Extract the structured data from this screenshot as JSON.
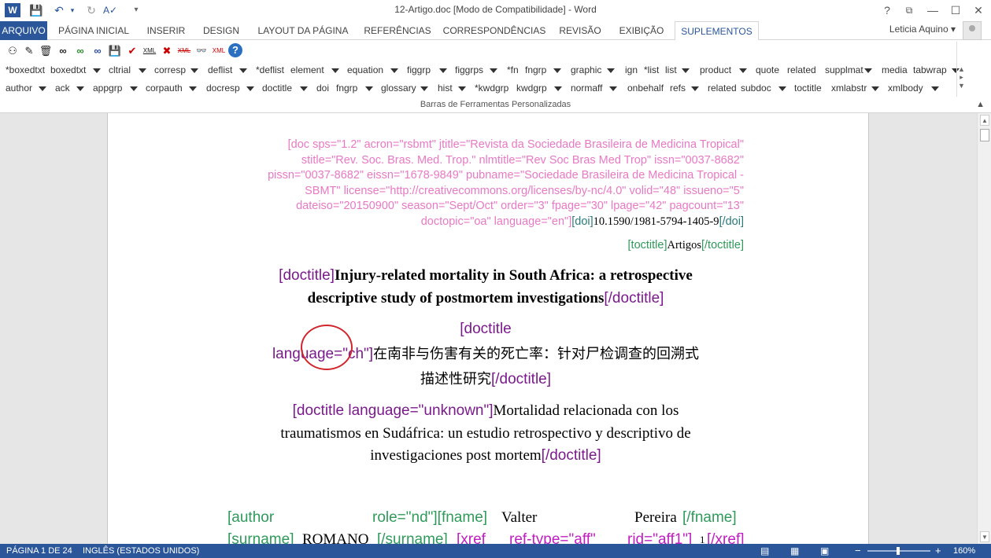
{
  "window": {
    "title": "12-Artigo.doc [Modo de Compatibilidade] - Word",
    "help": "?",
    "restore_ribbon": "⧉",
    "minimize": "—",
    "maximize": "☐",
    "close": "✕"
  },
  "quick_access": {
    "app_icon": "W",
    "save_icon": "💾",
    "undo_icon": "↶",
    "redo_icon": "↻",
    "spell_icon": "A✓",
    "customize_icon": "▾"
  },
  "tabs": [
    {
      "label": "ARQUIVO"
    },
    {
      "label": "PÁGINA INICIAL"
    },
    {
      "label": "INSERIR"
    },
    {
      "label": "DESIGN"
    },
    {
      "label": "LAYOUT DA PÁGINA"
    },
    {
      "label": "REFERÊNCIAS"
    },
    {
      "label": "CORRESPONDÊNCIAS"
    },
    {
      "label": "REVISÃO"
    },
    {
      "label": "EXIBIÇÃO"
    },
    {
      "label": "SUPLEMENTOS"
    }
  ],
  "user": {
    "name": "Leticia Aquino"
  },
  "toolbar_icons": [
    "person-icon",
    "pen-icon",
    "trash-icon",
    "glasses-icon",
    "glasses-green-icon",
    "glasses-blue-icon",
    "floppy-icon",
    "checkmark-icon",
    "xml-icon",
    "x-icon",
    "xml-strike-icon",
    "view-icon",
    "xml-grid-icon",
    "help-icon"
  ],
  "toolbar_icon_glyphs": [
    "⚇",
    "✎",
    "🗑",
    "∞",
    "∞",
    "∞",
    "💾",
    "✔",
    "XML",
    "✖",
    "XML",
    "👓",
    "XML",
    "?"
  ],
  "toolbar_row1": [
    "*boxedtxt",
    "boxedtxt",
    "cltrial",
    "corresp",
    "deflist",
    "*deflist",
    "element",
    "equation",
    "figgrp",
    "figgrps",
    "*fn",
    "fngrp",
    "graphic",
    "ign",
    "*list",
    "list",
    "product",
    "quote",
    "related",
    "supplmat",
    "media",
    "tabwrap"
  ],
  "toolbar_row2": [
    "author",
    "ack",
    "appgrp",
    "corpauth",
    "docresp",
    "doctitle",
    "doi",
    "fngrp",
    "glossary",
    "hist",
    "*kwdgrp",
    "kwdgrp",
    "normaff",
    "onbehalf",
    "refs",
    "related",
    "subdoc",
    "toctitle",
    "xmlabstr",
    "xmlbody"
  ],
  "toolbar_group_name": "Barras de Ferramentas Personalizadas",
  "document": {
    "doc_tag_lines": [
      "[doc sps=\"1.2\" acron=\"rsbmt\" jtitle=\"Revista da Sociedade Brasileira de Medicina Tropical\"",
      "stitle=\"Rev. Soc. Bras. Med. Trop.\" nlmtitle=\"Rev Soc Bras Med Trop\" issn=\"0037-8682\"",
      "pissn=\"0037-8682\" eissn=\"1678-9849\" pubname=\"Sociedade Brasileira de Medicina Tropical -",
      "SBMT\" license=\"http://creativecommons.org/licenses/by-nc/4.0\" volid=\"48\" issueno=\"5\"",
      "dateiso=\"20150900\" season=\"Sept/Oct\" order=\"3\" fpage=\"30\" lpage=\"42\" pagcount=\"13\""
    ],
    "doc_tag_last": "doctopic=\"oa\" language=\"en\"]",
    "doi_open": "[doi]",
    "doi_value": "10.1590/1981-5794-1405-9",
    "doi_close": "[/doi]",
    "toctitle_open": "[toctitle]",
    "toctitle_value": "Artigos",
    "toctitle_close": "[/toctitle]",
    "title_en_open": "[doctitle]",
    "title_en_line1": "Injury-related mortality in South Africa: a retrospective",
    "title_en_line2": "descriptive study of postmortem investigations",
    "title_close": "[/doctitle]",
    "title_ch_open_1": "[doctitle",
    "title_ch_open_2": "language=\"ch\"]",
    "title_ch_line1": "在南非与伤害有关的死亡率：针对尸检调查的回溯式",
    "title_ch_line2": "描述性研究",
    "title_es_open": "[doctitle language=\"unknown\"]",
    "title_es_line1": "Mortalidad relacionada con los",
    "title_es_line2": "traumatismos en Sudáfrica: un estudio retrospectivo y descriptivo de",
    "title_es_line3": "investigaciones post mortem",
    "author_open": "[author",
    "author_role": "role=\"nd\"][fname]",
    "author_fname": "Valter",
    "author_fname_2": "Pereira",
    "author_fname_close": "[/fname]",
    "surname_open": "[surname]",
    "surname_value": "ROMANO",
    "surname_close": "[/surname]",
    "xref_open": "[xref",
    "xref_type": "ref-type=\"aff\"",
    "xref_rid": "rid=\"aff1\"]",
    "xref_value": "1",
    "xref_close": "[/xref]"
  },
  "status": {
    "page": "PÁGINA 1 DE 24",
    "language": "INGLÊS (ESTADOS UNIDOS)",
    "zoom": "160%",
    "zoom_minus": "−",
    "zoom_plus": "+"
  },
  "colors": {
    "accent": "#2b579a",
    "tag_pink": "#e879c5",
    "tag_purple": "#7b1a8c",
    "tag_green": "#2f9a5a",
    "annotation_red": "#d0262c"
  }
}
